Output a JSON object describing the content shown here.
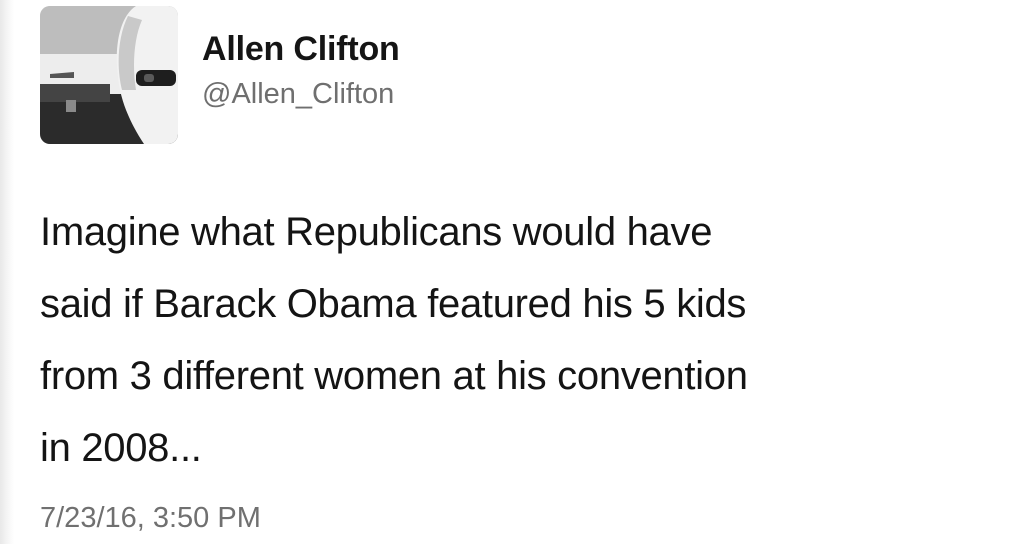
{
  "tweet": {
    "author": {
      "display_name": "Allen Clifton",
      "handle": "@Allen_Clifton",
      "avatar_icon": "profile-photo-icon"
    },
    "text_lines": [
      "Imagine what Republicans would have",
      "said if Barack Obama featured his 5 kids",
      "from 3 different women at his convention",
      "in 2008..."
    ],
    "timestamp": "7/23/16, 3:50 PM"
  },
  "colors": {
    "background": "#ffffff",
    "name_text": "#151515",
    "body_text": "#141414",
    "secondary_text": "#6f6f6f"
  }
}
